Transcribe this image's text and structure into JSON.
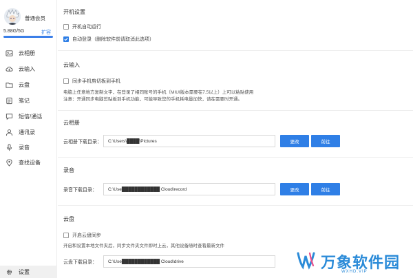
{
  "sidebar": {
    "member_label": "普通会员",
    "storage_text": "5.88G/5G",
    "expand_label": "扩容",
    "storage_fraction": 1.0,
    "items": [
      {
        "label": "云相册",
        "icon": "photo-icon"
      },
      {
        "label": "云输入",
        "icon": "cloud-input-icon"
      },
      {
        "label": "云盘",
        "icon": "folder-icon"
      },
      {
        "label": "笔记",
        "icon": "note-icon"
      },
      {
        "label": "短信/通话",
        "icon": "message-icon"
      },
      {
        "label": "通讯录",
        "icon": "contacts-icon"
      },
      {
        "label": "录音",
        "icon": "mic-icon"
      },
      {
        "label": "查找设备",
        "icon": "location-icon"
      }
    ],
    "settings_label": "设置"
  },
  "startup": {
    "title": "开机设置",
    "autostart_label": "开机自动运行",
    "autostart_checked": false,
    "autologin_label": "自动登录（删除软件前请取消此选项）",
    "autologin_checked": true
  },
  "cloud_input": {
    "title": "云输入",
    "sync_label": "同步手机剪切板到手机",
    "sync_checked": false,
    "note1": "电脑上任意地方复制文字，在登录了相同账号的手机（MIUI版本需要在7.5以上）上可以粘贴使用",
    "note2": "注意：开通同步电脑剪贴板到手机功能，可能导致您的手机耗电量加快，请在需要时开通。"
  },
  "album": {
    "title": "云相册",
    "field_label": "云相册下载目录：",
    "path": "C:\\Users\\████\\Pictures",
    "change_label": "更改",
    "open_label": "前往"
  },
  "record": {
    "title": "录音",
    "field_label": "录音下载目录：",
    "path": "C:\\Use████████████ Cloud\\record",
    "change_label": "更改",
    "open_label": "前往"
  },
  "disk": {
    "title": "云盘",
    "sync_label": "开启云盘同步",
    "sync_checked": false,
    "note": "开启和设置本地文件夹后，同步文件夹文件即时上云，其他设备随时查看最新文件",
    "field_label": "云盘下载目录：",
    "path": "C:\\Use████████████ Cloud\\drive"
  },
  "watermark": {
    "text": "万象软件园",
    "url": "WXHD.VIP"
  },
  "colors": {
    "accent": "#2f7fe6",
    "watermark": "#2b8bd8"
  }
}
